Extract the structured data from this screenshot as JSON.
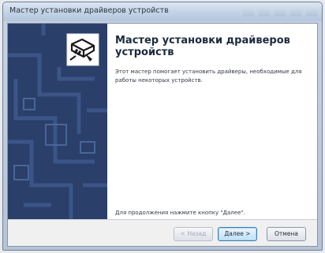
{
  "window": {
    "title": "Мастер установки драйверов устройств"
  },
  "wizard": {
    "heading": "Мастер установки драйверов устройств",
    "description": "Этот мастер помогает установить драйверы, необходимые для работы некоторых устройств.",
    "footer_note": "Для продолжения нажмите кнопку \"Далее\"."
  },
  "buttons": {
    "back": "< Назад",
    "next": "Далее >",
    "cancel": "Отмена"
  },
  "colors": {
    "sidebar": "#2a3f69",
    "default_button_border": "#3c7fb1"
  }
}
